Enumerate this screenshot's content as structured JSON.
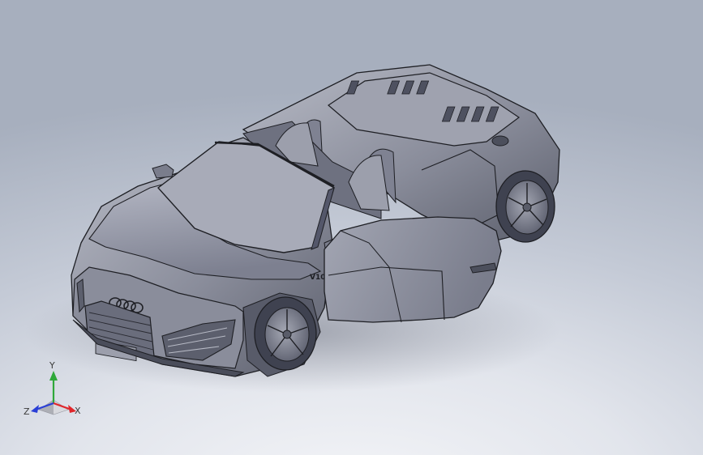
{
  "viewport": {
    "model": "car-convertible-doors-open",
    "emblem_icon": "four-rings-logo",
    "colors": {
      "background_top": "#a7afbe",
      "background_bottom": "#f4f5f8",
      "body": "#8a8d9b",
      "body_highlight": "#b9bcc7",
      "body_shadow": "#5b5e6b",
      "edges": "#1e1f24"
    }
  },
  "triad": {
    "x_label": "X",
    "y_label": "Y",
    "z_label": "Z",
    "colors": {
      "x": "#e0262b",
      "y": "#2fa83a",
      "z": "#2a3fd6"
    }
  }
}
